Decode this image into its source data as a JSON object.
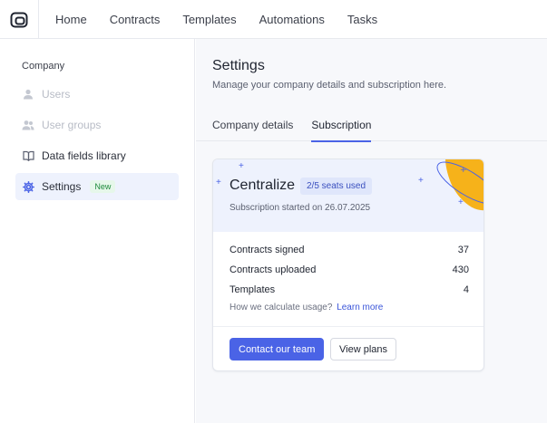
{
  "topnav": {
    "logo_icon": "app-logo-icon",
    "items": [
      {
        "label": "Home"
      },
      {
        "label": "Contracts"
      },
      {
        "label": "Templates"
      },
      {
        "label": "Automations"
      },
      {
        "label": "Tasks"
      }
    ]
  },
  "sidebar": {
    "section_title": "Company",
    "items": [
      {
        "label": "Users",
        "icon": "user-icon",
        "state": "disabled"
      },
      {
        "label": "User groups",
        "icon": "user-group-icon",
        "state": "disabled"
      },
      {
        "label": "Data fields library",
        "icon": "book-icon",
        "state": "normal"
      },
      {
        "label": "Settings",
        "icon": "gear-icon",
        "state": "active",
        "badge": "New"
      }
    ]
  },
  "main": {
    "title": "Settings",
    "subtitle": "Manage your company details and subscription here.",
    "tabs": [
      {
        "label": "Company details",
        "active": false
      },
      {
        "label": "Subscription",
        "active": true
      }
    ]
  },
  "subscription": {
    "plan_name": "Centralize",
    "seats_badge": "2/5 seats used",
    "started": "Subscription started on 26.07.2025",
    "usage": [
      {
        "label": "Contracts signed",
        "value": "37"
      },
      {
        "label": "Contracts uploaded",
        "value": "430"
      },
      {
        "label": "Templates",
        "value": "4"
      }
    ],
    "calc_note": "How we calculate usage?",
    "learn_more": "Learn more",
    "contact_button": "Contact our team",
    "view_plans_button": "View plans"
  },
  "colors": {
    "accent": "#4a63e6",
    "active_bg": "#eef2fd",
    "badge_green": "#1e8a3c",
    "deco_yellow": "#f6b21a"
  }
}
